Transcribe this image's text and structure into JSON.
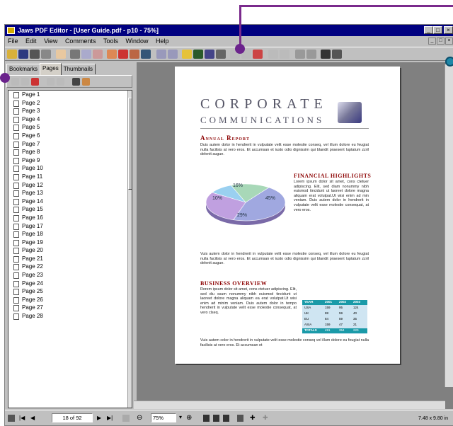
{
  "window": {
    "title": "Jaws PDF Editor - [User Guide.pdf - p10 - 75%]",
    "controls": [
      "_",
      "□",
      "×"
    ],
    "mdi_controls": [
      "_",
      "□",
      "×"
    ]
  },
  "menu": [
    "File",
    "Edit",
    "View",
    "Comments",
    "Tools",
    "Window",
    "Help"
  ],
  "toolbar": {
    "icons": [
      "open-icon",
      "save-icon",
      "print-icon",
      "print-preview-icon",
      "hand-icon",
      "cut-icon",
      "copy-icon",
      "paste-icon",
      "insert-page-icon",
      "delete-page-icon",
      "rotate-page-icon",
      "crop-icon",
      "undo-icon",
      "redo-icon",
      "note-icon",
      "pencil-icon",
      "underline-icon",
      "spell-icon",
      "text-insert-icon",
      "link-icon",
      "bookmark-add-icon",
      "page-nav-icon",
      "page-nav2-icon",
      "two-page-icon",
      "fit-page-icon",
      "find-icon",
      "find-next-icon"
    ]
  },
  "left_panel": {
    "tabs": [
      "Bookmarks",
      "Pages",
      "Thumbnails"
    ],
    "active_tab": "Pages",
    "pages": [
      "Page 1",
      "Page 2",
      "Page 3",
      "Page 4",
      "Page 5",
      "Page 6",
      "Page 7",
      "Page 8",
      "Page 9",
      "Page 10",
      "Page 11",
      "Page 12",
      "Page 13",
      "Page 14",
      "Page 15",
      "Page 16",
      "Page 17",
      "Page 18",
      "Page 19",
      "Page 20",
      "Page 21",
      "Page 22",
      "Page 23",
      "Page 24",
      "Page 25",
      "Page 26",
      "Page 27",
      "Page 28"
    ]
  },
  "document": {
    "heading1": "CORPORATE",
    "heading2": "COMMUNICATIONS",
    "annual_report": "Annual Report",
    "intro": "Duis autem dolor in hendrerit in vulputate velit esse molestie conseq, vel illum dolore eu feugiat nulla facilisis at vero eros. Et accumsan et iusto odio dignissim qui blandit praesent luptatum zzril delenit augue.",
    "financial_highlights": "FINANCIAL HIGHLIGHTS",
    "fin_text": "Lorem ipsum dolor sit amet, cons ctetuer adipiscing. Elit, sed diam nonummy nibh euismod tincidunt ut laoreet dolore magna aliquam erat volutpat.Ut wisi enim ad min veniam. Duis autem dolor in hendrerit in vulputate velit esse molestie consequat, at vero eros.",
    "mid_text": "Vuis autem dolor in hendrerit in vulputate velit esse molestie conseq, vel illum dolore eu feugiat nulla facilisis at vero eros. Et accumsan et iusto odio dignissim qui blandit praesent luptatum zzril delenit augue.",
    "business_overview": "BUSINESS OVERVIEW",
    "biz_text": "Rorem ipsum dolor sit amet, cons ctetuer adipiscing. Elit, sed diu ssum nonummy nibh euismod tincidunt ut laoreet dolore magna aliquam ea erat volutpat.Ut wisi enim ad minim veniam. Duis autem dolor in tempo hendrerit in vulputate velit esse molestie consequat, at vero clseq.",
    "closing_text": "Vuis autem color in hendrerit in vulputate velit esse molestie conseq vel illum dolore eu feugiat nulla facilisis at vero eros. Et accumsan et",
    "pie": {
      "labels": [
        "16%",
        "45%",
        "10%",
        "29%"
      ],
      "colors": [
        "#a8d8b8",
        "#a0a8e0",
        "#9ad0f0",
        "#c0a0e0"
      ]
    },
    "table": {
      "header": [
        "YEAR",
        "2001",
        "2002",
        "2003"
      ],
      "rows": [
        [
          "USA",
          "159",
          "95",
          "124"
        ],
        [
          "UK",
          "88",
          "59",
          "40"
        ],
        [
          "EU",
          "84",
          "59",
          "35"
        ],
        [
          "ASIA",
          "159",
          "47",
          "21"
        ]
      ],
      "total_label": "TOTALS",
      "totals": [
        "491",
        "354",
        "220"
      ]
    }
  },
  "status": {
    "page": "18 of 92",
    "zoom": "75%",
    "size": "7.48 x 9.80 in"
  }
}
